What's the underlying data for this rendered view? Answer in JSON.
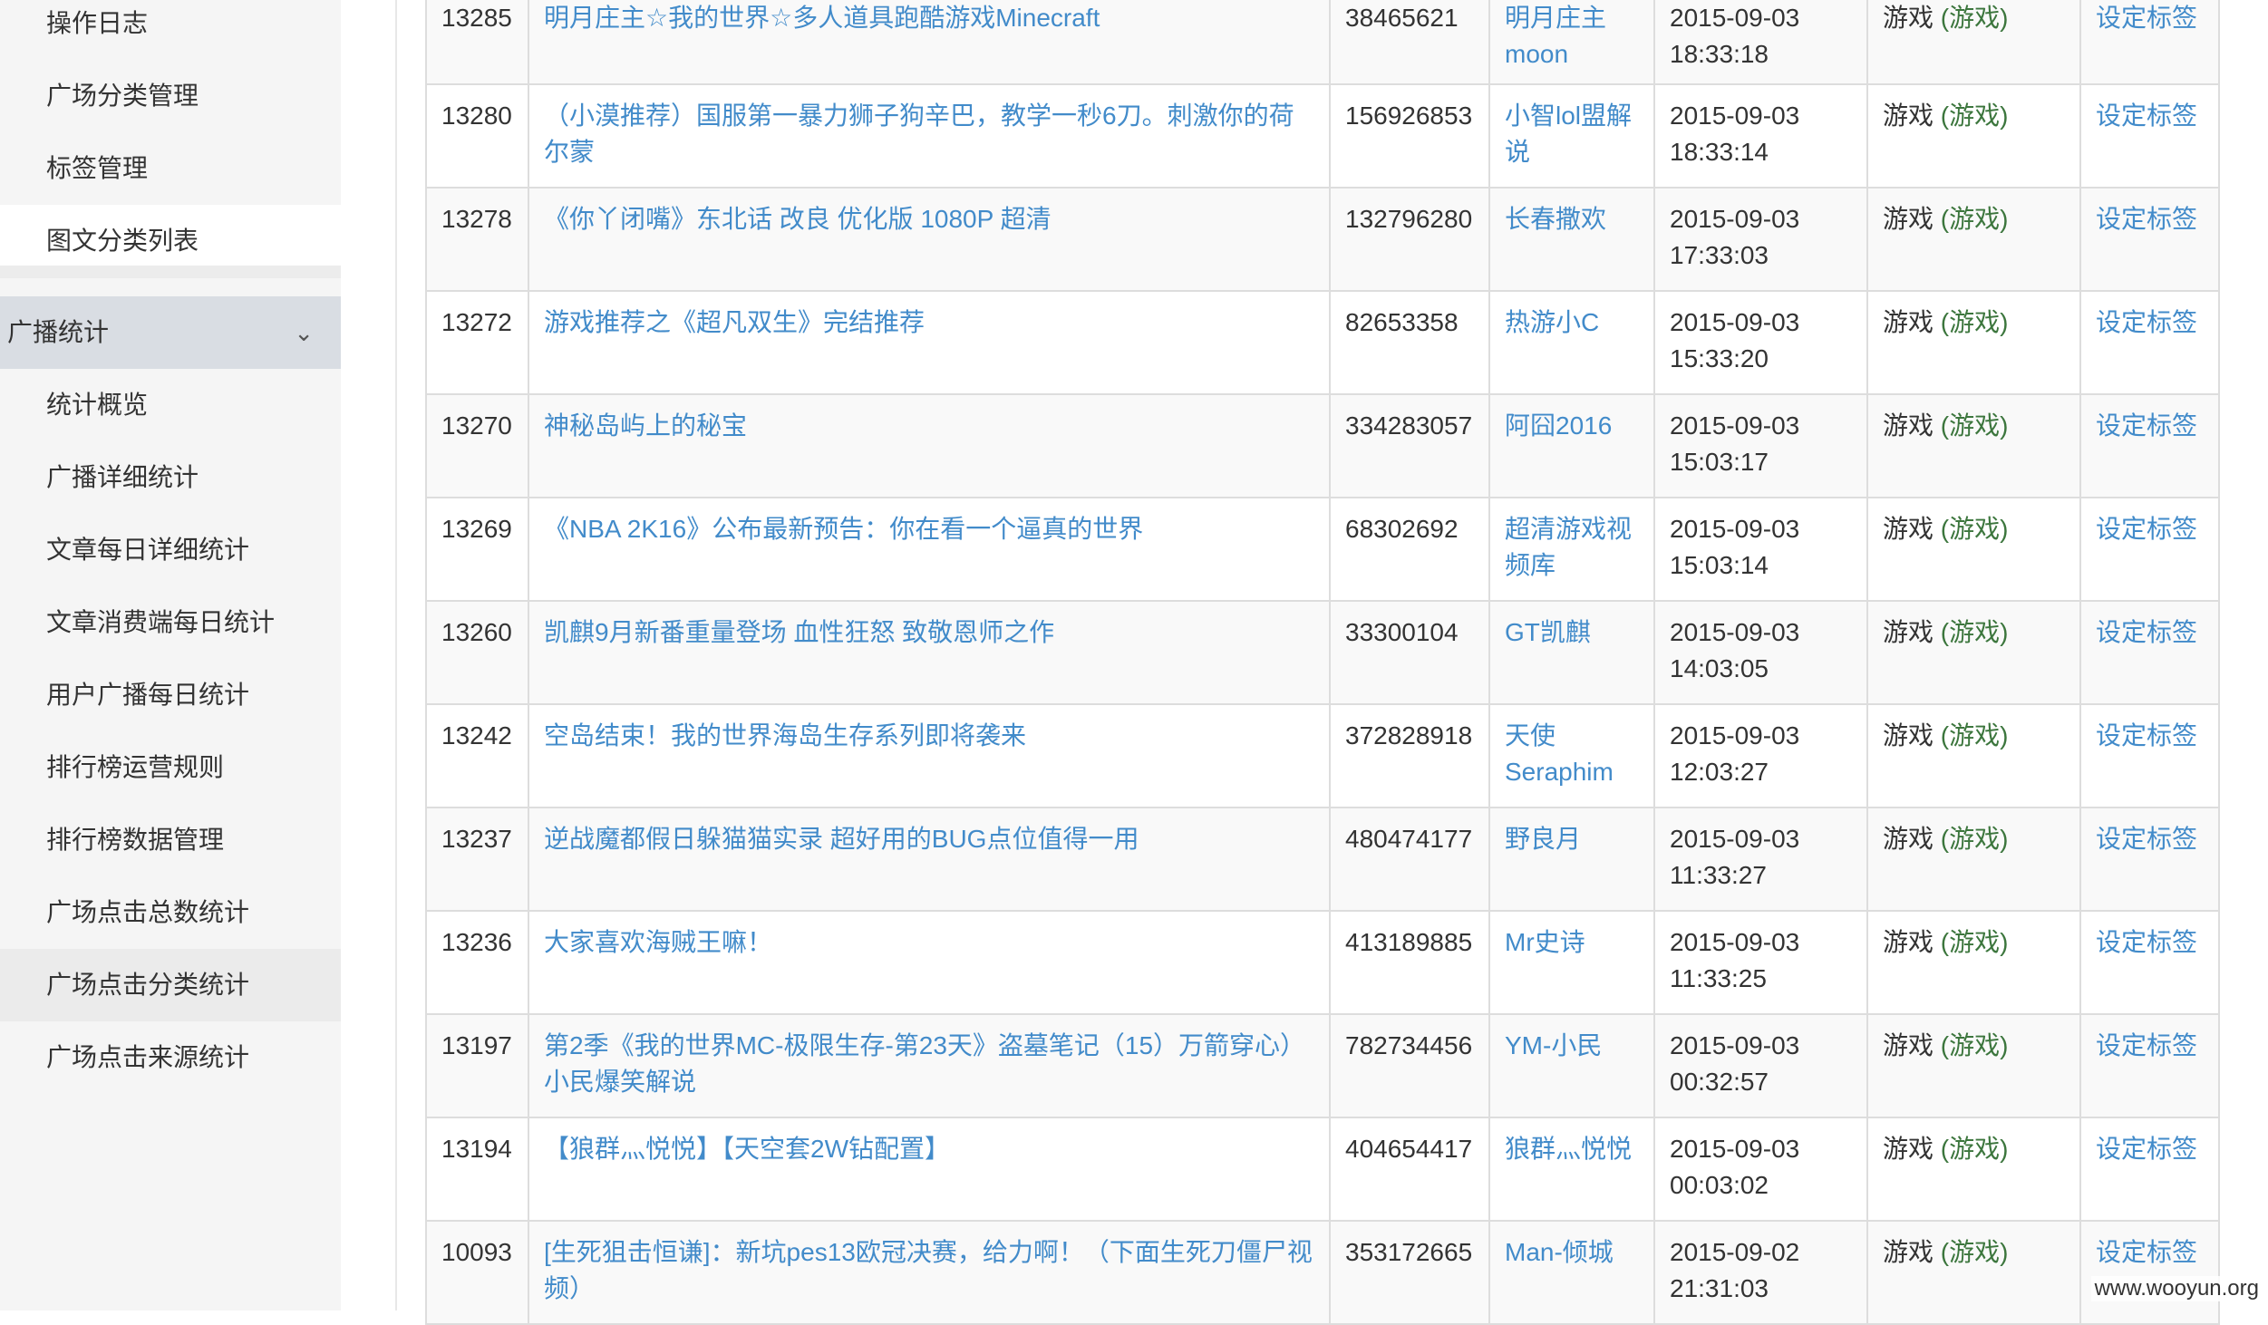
{
  "sidebar": {
    "items_top": [
      {
        "label": "操作日志"
      },
      {
        "label": "广场分类管理"
      },
      {
        "label": "标签管理"
      },
      {
        "label": "图文分类列表"
      }
    ],
    "group": {
      "label": "广播统计",
      "icon": "chevron-down-icon",
      "glyph": "⌄"
    },
    "items_bottom": [
      {
        "label": "统计概览"
      },
      {
        "label": "广播详细统计"
      },
      {
        "label": "文章每日详细统计"
      },
      {
        "label": "文章消费端每日统计"
      },
      {
        "label": "用户广播每日统计"
      },
      {
        "label": "排行榜运营规则"
      },
      {
        "label": "排行榜数据管理"
      },
      {
        "label": "广场点击总数统计"
      },
      {
        "label": "广场点击分类统计"
      },
      {
        "label": "广场点击来源统计"
      }
    ],
    "active_label": "广场点击分类统计"
  },
  "table": {
    "rows": [
      {
        "id": "13285",
        "title": "明月庄主☆我的世界☆多人道具跑酷游戏Minecraft",
        "uid": "38465621",
        "user": "明月庄主moon",
        "date": "2015-09-03",
        "time": "18:33:18",
        "cat": "游戏",
        "cat_tag": "(游戏)",
        "action": "设定标签"
      },
      {
        "id": "13280",
        "title": "（小漠推荐）国服第一暴力狮子狗辛巴，教学一秒6刀。刺激你的荷尔蒙",
        "uid": "156926853",
        "user": "小智lol盟解说",
        "date": "2015-09-03",
        "time": "18:33:14",
        "cat": "游戏",
        "cat_tag": "(游戏)",
        "action": "设定标签"
      },
      {
        "id": "13278",
        "title": "《你丫闭嘴》东北话 改良 优化版 1080P 超清",
        "uid": "132796280",
        "user": "长春撒欢",
        "date": "2015-09-03",
        "time": "17:33:03",
        "cat": "游戏",
        "cat_tag": "(游戏)",
        "action": "设定标签"
      },
      {
        "id": "13272",
        "title": "游戏推荐之《超凡双生》完结推荐",
        "uid": "82653358",
        "user": "热游小C",
        "date": "2015-09-03",
        "time": "15:33:20",
        "cat": "游戏",
        "cat_tag": "(游戏)",
        "action": "设定标签"
      },
      {
        "id": "13270",
        "title": "神秘岛屿上的秘宝",
        "uid": "334283057",
        "user": "阿囧2016",
        "date": "2015-09-03",
        "time": "15:03:17",
        "cat": "游戏",
        "cat_tag": "(游戏)",
        "action": "设定标签"
      },
      {
        "id": "13269",
        "title": "《NBA 2K16》公布最新预告：你在看一个逼真的世界",
        "uid": "68302692",
        "user": "超清游戏视频库",
        "date": "2015-09-03",
        "time": "15:03:14",
        "cat": "游戏",
        "cat_tag": "(游戏)",
        "action": "设定标签"
      },
      {
        "id": "13260",
        "title": "凯麒9月新番重量登场 血性狂怒 致敬恩师之作",
        "uid": "33300104",
        "user": "GT凯麒",
        "date": "2015-09-03",
        "time": "14:03:05",
        "cat": "游戏",
        "cat_tag": "(游戏)",
        "action": "设定标签"
      },
      {
        "id": "13242",
        "title": "空岛结束！我的世界海岛生存系列即将袭来",
        "uid": "372828918",
        "user": "天使Seraphim",
        "date": "2015-09-03",
        "time": "12:03:27",
        "cat": "游戏",
        "cat_tag": "(游戏)",
        "action": "设定标签"
      },
      {
        "id": "13237",
        "title": "逆战魔都假日躲猫猫实录 超好用的BUG点位值得一用",
        "uid": "480474177",
        "user": "野良月",
        "date": "2015-09-03",
        "time": "11:33:27",
        "cat": "游戏",
        "cat_tag": "(游戏)",
        "action": "设定标签"
      },
      {
        "id": "13236",
        "title": "大家喜欢海贼王嘛！",
        "uid": "413189885",
        "user": "Mr史诗",
        "date": "2015-09-03",
        "time": "11:33:25",
        "cat": "游戏",
        "cat_tag": "(游戏)",
        "action": "设定标签"
      },
      {
        "id": "13197",
        "title": "第2季《我的世界MC-极限生存-第23天》盗墓笔记（15）万箭穿心）小民爆笑解说",
        "uid": "782734456",
        "user": "YM-小民",
        "date": "2015-09-03",
        "time": "00:32:57",
        "cat": "游戏",
        "cat_tag": "(游戏)",
        "action": "设定标签"
      },
      {
        "id": "13194",
        "title": "【狼群灬悦悦】【天空套2W钻配置】",
        "uid": "404654417",
        "user": "狼群灬悦悦",
        "date": "2015-09-03",
        "time": "00:03:02",
        "cat": "游戏",
        "cat_tag": "(游戏)",
        "action": "设定标签"
      },
      {
        "id": "10093",
        "title": "[生死狙击恒谦]：新坑pes13欧冠决赛，给力啊！（下面生死刀僵尸视频）",
        "uid": "353172665",
        "user": "Man-倾城",
        "date": "2015-09-02",
        "time": "21:31:03",
        "cat": "游戏",
        "cat_tag": "(游戏)",
        "action": "设定标签"
      }
    ]
  },
  "watermark": "www.wooyun.org"
}
